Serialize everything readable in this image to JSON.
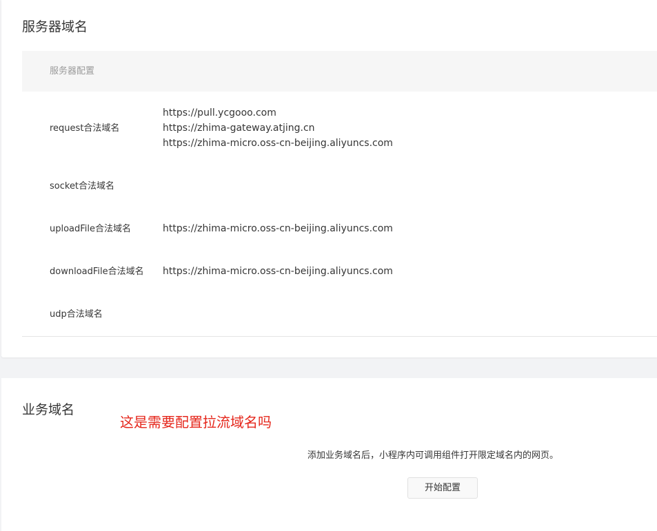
{
  "server_section": {
    "title": "服务器域名",
    "table_header": "服务器配置",
    "rows": [
      {
        "label": "request合法域名",
        "values": [
          "https://pull.ycgooo.com",
          "https://zhima-gateway.atjing.cn",
          "https://zhima-micro.oss-cn-beijing.aliyuncs.com"
        ]
      },
      {
        "label": "socket合法域名",
        "values": []
      },
      {
        "label": "uploadFile合法域名",
        "values": [
          "https://zhima-micro.oss-cn-beijing.aliyuncs.com"
        ]
      },
      {
        "label": "downloadFile合法域名",
        "values": [
          "https://zhima-micro.oss-cn-beijing.aliyuncs.com"
        ]
      },
      {
        "label": "udp合法域名",
        "values": []
      }
    ]
  },
  "business_section": {
    "title": "业务域名",
    "annotation": "这是需要配置拉流域名吗",
    "description": "添加业务域名后，小程序内可调用组件打开限定域名内的网页。",
    "button_label": "开始配置"
  },
  "colors": {
    "annotation": "#e5261b",
    "background": "#f2f3f5",
    "card": "#ffffff",
    "table_header_bg": "#f6f6f6"
  }
}
